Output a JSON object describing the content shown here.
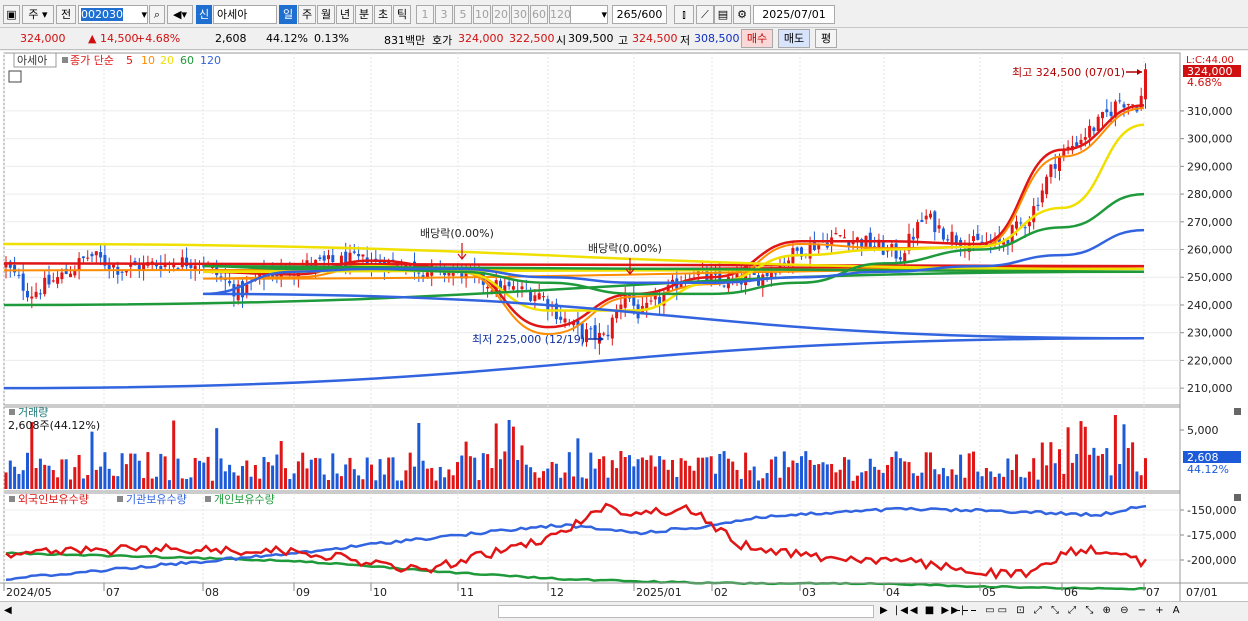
{
  "toolbar": {
    "mode1": "주",
    "mode2": "전",
    "code": "002030",
    "name_badge": "신",
    "name": "아세아",
    "periods": [
      "일",
      "주",
      "월",
      "년",
      "분",
      "초",
      "틱"
    ],
    "intervals": [
      "1",
      "3",
      "5",
      "10",
      "20",
      "30",
      "60",
      "120"
    ],
    "count": "265",
    "count_total": "/600",
    "date": "2025/07/01"
  },
  "quote": {
    "price": "324,000",
    "change": "▲ 14,500",
    "change_pct": "+4.68%",
    "volume": "2,608",
    "volume_pct": "44.12%",
    "turnover_pct": "0.13%",
    "amount": "831백만",
    "ask_label": "호가",
    "ask": "324,000",
    "bid": "322,500",
    "open_label": "시",
    "open": "309,500",
    "high_label": "고",
    "high": "324,500",
    "low_label": "저",
    "low": "308,500",
    "buy_button": "매수",
    "sell_button": "매도",
    "eval_button": "평"
  },
  "price_panel": {
    "name_tag": "아세아",
    "legend_close": "종가 단순",
    "ma_periods": [
      "5",
      "10",
      "20",
      "60",
      "120"
    ],
    "top_axis_label": "L:C:44.00",
    "current_badge": "324,000",
    "current_pct": "4.68%",
    "high_annotation": "최고 324,500 (07/01)",
    "low_annotation": "최저 225,000 (12/19)",
    "dividend_annotation": "배당락(0.00%)",
    "y_ticks": [
      "310,000",
      "300,000",
      "290,000",
      "280,000",
      "270,000",
      "260,000",
      "250,000",
      "240,000",
      "230,000",
      "220,000",
      "210,000"
    ]
  },
  "volume_panel": {
    "title": "거래량",
    "summary": "2,608주(44.12%)",
    "y_tick": "5,000",
    "current_badge": "2,608",
    "current_pct": "44.12%"
  },
  "holding_panel": {
    "legend": [
      "외국인보유수량",
      "기관보유수량",
      "개인보유수량"
    ],
    "y_ticks": [
      "-150,000",
      "-175,000",
      "-200,000"
    ]
  },
  "x_axis": {
    "labels": [
      "2024/05",
      "07",
      "08",
      "09",
      "10",
      "11",
      "12",
      "2025/01",
      "02",
      "03",
      "04",
      "05",
      "06",
      "07"
    ],
    "right_label": "07/01"
  },
  "colors": {
    "up": "#e01515",
    "down": "#1c5ad8",
    "ma5": "#e01515",
    "ma10": "#ff8c00",
    "ma20": "#f0e000",
    "ma60": "#1e9a3a",
    "ma120": "#3264e0",
    "foreign": "#e01515",
    "institution": "#3264e0",
    "individual": "#1e9a3a"
  },
  "chart_data": {
    "type": "candlestick",
    "ylim": [
      205000,
      328000
    ],
    "title": "",
    "series": [
      {
        "name": "5",
        "points": [
          [
            "2024/05",
            255000
          ],
          [
            "07",
            254000
          ],
          [
            "08",
            252000
          ],
          [
            "09",
            251000
          ],
          [
            "10",
            256000
          ],
          [
            "11",
            253000
          ],
          [
            "12",
            232000
          ],
          [
            "2025/01",
            244000
          ],
          [
            "02",
            250000
          ],
          [
            "03",
            263000
          ],
          [
            "04",
            263000
          ],
          [
            "05",
            262000
          ],
          [
            "06",
            296000
          ],
          [
            "07",
            312000
          ]
        ]
      },
      {
        "name": "20",
        "points": [
          [
            "2024/05",
            262000
          ],
          [
            "07",
            253000
          ],
          [
            "08",
            252000
          ],
          [
            "09",
            252000
          ],
          [
            "10",
            254000
          ],
          [
            "11",
            252000
          ],
          [
            "12",
            238000
          ],
          [
            "2025/01",
            238000
          ],
          [
            "02",
            248000
          ],
          [
            "03",
            258000
          ],
          [
            "04",
            260000
          ],
          [
            "05",
            261000
          ],
          [
            "06",
            275000
          ],
          [
            "07",
            305000
          ]
        ]
      },
      {
        "name": "60",
        "points": [
          [
            "2024/05",
            240000
          ],
          [
            "07",
            252000
          ],
          [
            "08",
            254000
          ],
          [
            "09",
            253000
          ],
          [
            "10",
            253000
          ],
          [
            "11",
            252000
          ],
          [
            "12",
            248000
          ],
          [
            "2025/01",
            244000
          ],
          [
            "02",
            244000
          ],
          [
            "03",
            248000
          ],
          [
            "04",
            255000
          ],
          [
            "05",
            260000
          ],
          [
            "06",
            268000
          ],
          [
            "07",
            280000
          ]
        ]
      },
      {
        "name": "120",
        "points": [
          [
            "2024/05",
            210000
          ],
          [
            "07",
            228000
          ],
          [
            "08",
            244000
          ],
          [
            "09",
            252000
          ],
          [
            "10",
            253000
          ],
          [
            "11",
            253000
          ],
          [
            "12",
            250000
          ],
          [
            "2025/01",
            248000
          ],
          [
            "02",
            248000
          ],
          [
            "03",
            250000
          ],
          [
            "04",
            252000
          ],
          [
            "05",
            254000
          ],
          [
            "06",
            258000
          ],
          [
            "07",
            267000
          ]
        ]
      }
    ],
    "extremes": {
      "high": 324500,
      "high_date": "07/01",
      "low": 225000,
      "low_date": "12/19"
    }
  }
}
